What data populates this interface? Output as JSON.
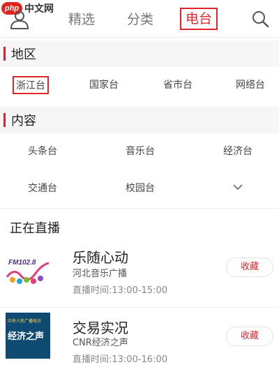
{
  "watermark": {
    "logo": "php",
    "text": "中文网"
  },
  "nav": {
    "tabs": [
      "精选",
      "分类",
      "电台"
    ],
    "active": "电台"
  },
  "region": {
    "title": "地区",
    "items": [
      "浙江台",
      "国家台",
      "省市台",
      "网络台"
    ],
    "selected": "浙江台"
  },
  "content": {
    "title": "内容",
    "items": [
      "头条台",
      "音乐台",
      "经济台",
      "交通台",
      "校园台"
    ]
  },
  "live": {
    "title": "正在直播",
    "items": [
      {
        "name": "乐随心动",
        "channel": "河北音乐广播",
        "time": "直播时间:13:00-15:00",
        "fav": "收藏",
        "logo_text": "FM102.8"
      },
      {
        "name": "交易实况",
        "channel": "CNR经济之声",
        "time": "直播时间:13:00-16:00",
        "fav": "收藏",
        "logo_text": "经济之声",
        "logo_sub": "中央人民广播电台"
      }
    ]
  },
  "colors": {
    "accent": "#e0262d",
    "section_bg": "#f6f6f6"
  },
  "icons": {
    "user": "user-icon",
    "search": "search-icon",
    "expand": "chevron-down-icon"
  }
}
